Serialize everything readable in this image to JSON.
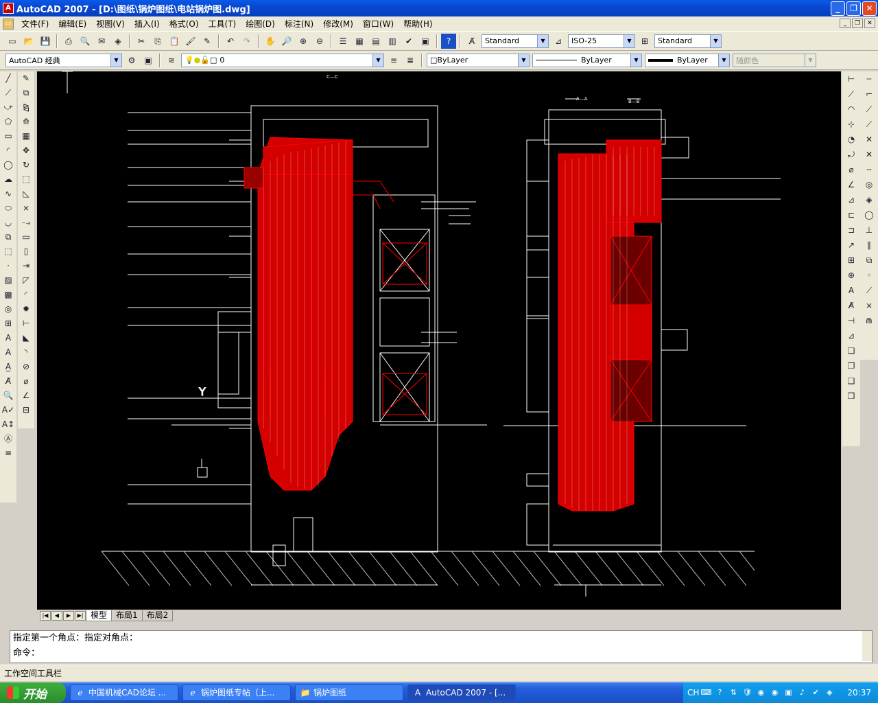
{
  "title_bar": {
    "title": "AutoCAD 2007 - [D:\\图纸\\锅炉图纸\\电站锅炉图.dwg]",
    "icon": "autocad-icon"
  },
  "menus": [
    "文件(F)",
    "编辑(E)",
    "视图(V)",
    "插入(I)",
    "格式(O)",
    "工具(T)",
    "绘图(D)",
    "标注(N)",
    "修改(M)",
    "窗口(W)",
    "帮助(H)"
  ],
  "styles": {
    "text_style": "Standard",
    "dim_style": "ISO-25",
    "table_style": "Standard"
  },
  "workspace": "AutoCAD 经典",
  "layer": "0",
  "properties": {
    "color": "ByLayer",
    "linetype": "ByLayer",
    "lineweight": "ByLayer",
    "plot_style": "随颜色"
  },
  "drawing_labels": {
    "section_left": "C—C",
    "section_right": "A—A",
    "section_right2": "B—B",
    "ucs_y": "Y"
  },
  "tabs": [
    "模型",
    "布局1",
    "布局2"
  ],
  "active_tab": "模型",
  "command": {
    "history": "指定第一个角点：指定对角点：",
    "prompt": "命令："
  },
  "status_text": "工作空间工具栏",
  "taskbar": {
    "start": "开始",
    "tasks": [
      "中国机械CAD论坛 ...",
      "锅炉图纸专帖（上...",
      "锅炉图纸",
      "AutoCAD 2007 - [..."
    ],
    "tray_lang": "CH",
    "clock": "20:37"
  },
  "colors": {
    "title": "#0848d0",
    "canvas": "#000000",
    "red": "#ff0000"
  }
}
